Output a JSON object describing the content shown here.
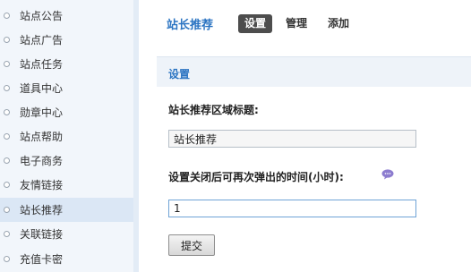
{
  "sidebar": {
    "items": [
      {
        "label": "站点公告"
      },
      {
        "label": "站点广告"
      },
      {
        "label": "站点任务"
      },
      {
        "label": "道具中心"
      },
      {
        "label": "勋章中心"
      },
      {
        "label": "站点帮助"
      },
      {
        "label": "电子商务"
      },
      {
        "label": "友情链接"
      },
      {
        "label": "站长推荐",
        "active": true
      },
      {
        "label": "关联链接"
      },
      {
        "label": "充值卡密"
      }
    ]
  },
  "header": {
    "title": "站长推荐",
    "tabs": [
      {
        "label": "设置",
        "active": true
      },
      {
        "label": "管理"
      },
      {
        "label": "添加"
      }
    ]
  },
  "section": {
    "title": "设置"
  },
  "form": {
    "field1_label": "站长推荐区域标题:",
    "field1_value": "站长推荐",
    "field2_label": "设置关闭后可再次弹出的时间(小时):",
    "field2_value": "1",
    "help_icon": "speech-bubble-icon",
    "submit_label": "提交"
  },
  "colors": {
    "accent": "#2b74c2",
    "active_tab": "#4d4d4d",
    "sidebar_bg": "#f2f6fb",
    "help_icon": "#8c7ccf"
  }
}
